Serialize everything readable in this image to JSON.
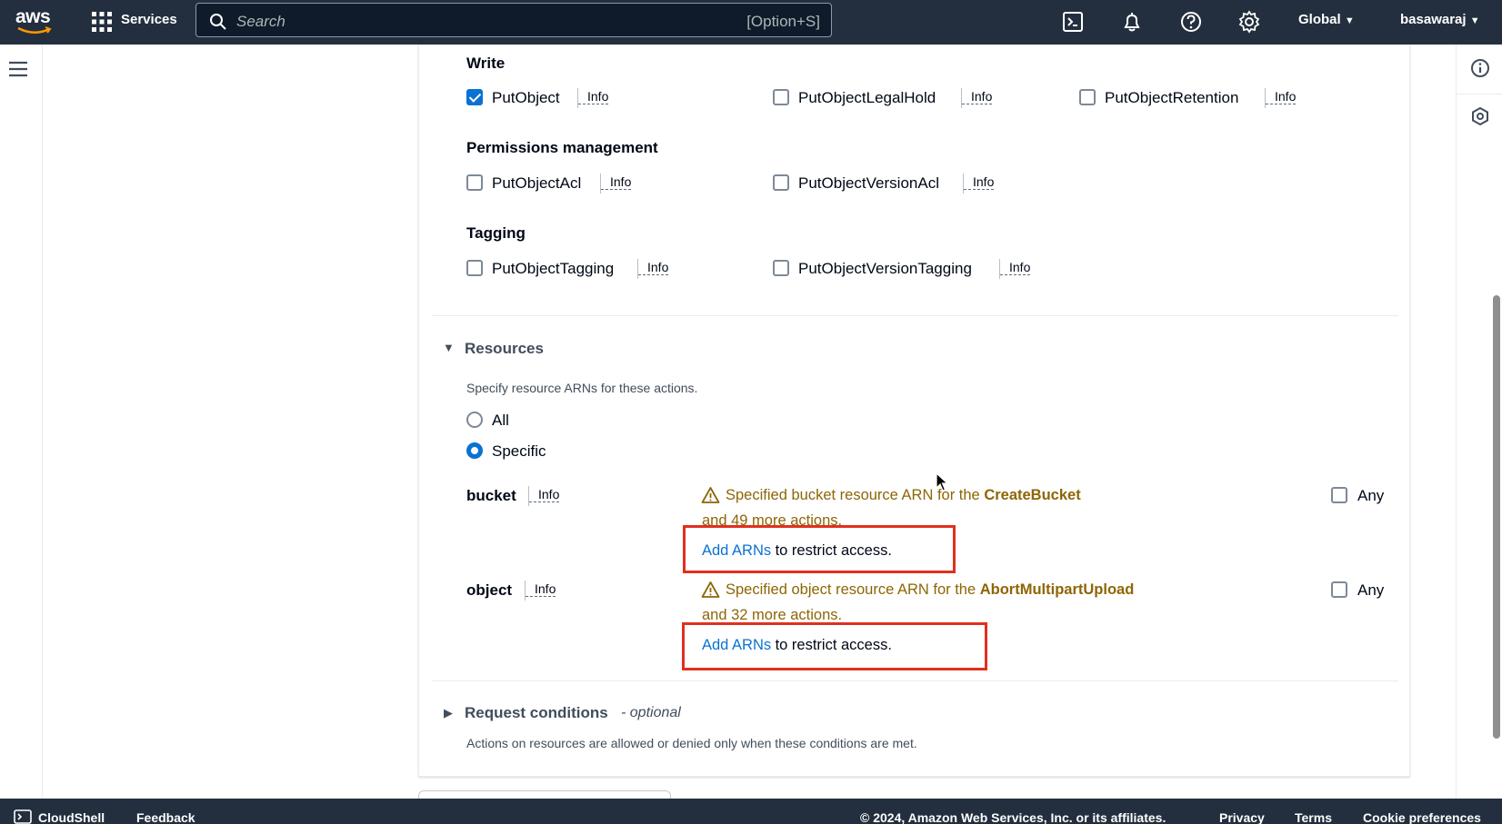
{
  "topnav": {
    "logo": "aws",
    "services_label": "Services",
    "search_placeholder": "Search",
    "search_shortcut": "[Option+S]",
    "region": "Global",
    "user": "basawaraj",
    "icons": [
      "cloudshell-icon",
      "bell-icon",
      "help-icon",
      "gear-icon"
    ]
  },
  "sections": {
    "write": {
      "title": "Write",
      "items": [
        {
          "label": "PutObject",
          "checked": true,
          "info": "Info"
        },
        {
          "label": "PutObjectLegalHold",
          "checked": false,
          "info": "Info"
        },
        {
          "label": "PutObjectRetention",
          "checked": false,
          "info": "Info"
        }
      ]
    },
    "permissions": {
      "title": "Permissions management",
      "items": [
        {
          "label": "PutObjectAcl",
          "checked": false,
          "info": "Info"
        },
        {
          "label": "PutObjectVersionAcl",
          "checked": false,
          "info": "Info"
        }
      ]
    },
    "tagging": {
      "title": "Tagging",
      "items": [
        {
          "label": "PutObjectTagging",
          "checked": false,
          "info": "Info"
        },
        {
          "label": "PutObjectVersionTagging",
          "checked": false,
          "info": "Info"
        }
      ]
    }
  },
  "resources": {
    "title": "Resources",
    "description": "Specify resource ARNs for these actions.",
    "options": [
      {
        "label": "All",
        "selected": false
      },
      {
        "label": "Specific",
        "selected": true
      }
    ],
    "rows": [
      {
        "name": "bucket",
        "info": "Info",
        "warn_prefix": "Specified bucket resource ARN for the ",
        "warn_action": "CreateBucket",
        "warn_suffix": "and 49 more actions.",
        "link": "Add ARNs",
        "after_link": "to restrict access.",
        "any": "Any"
      },
      {
        "name": "object",
        "info": "Info",
        "warn_prefix": "Specified object resource ARN for the ",
        "warn_action": "AbortMultipartUpload",
        "warn_suffix": "and 32 more actions.",
        "link": "Add ARNs",
        "after_link": "to restrict access.",
        "any": "Any"
      }
    ]
  },
  "conditions": {
    "title": "Request conditions",
    "optional": "- optional",
    "description": "Actions on resources are allowed or denied only when these conditions are met."
  },
  "footer": {
    "cloudshell": "CloudShell",
    "feedback": "Feedback",
    "copyright": "© 2024, Amazon Web Services, Inc. or its affiliates.",
    "privacy": "Privacy",
    "terms": "Terms",
    "cookies": "Cookie preferences"
  },
  "colors": {
    "nav_bg": "#232f3e",
    "accent": "#0972d3",
    "warning": "#8d6605",
    "highlight": "#e0301e"
  }
}
